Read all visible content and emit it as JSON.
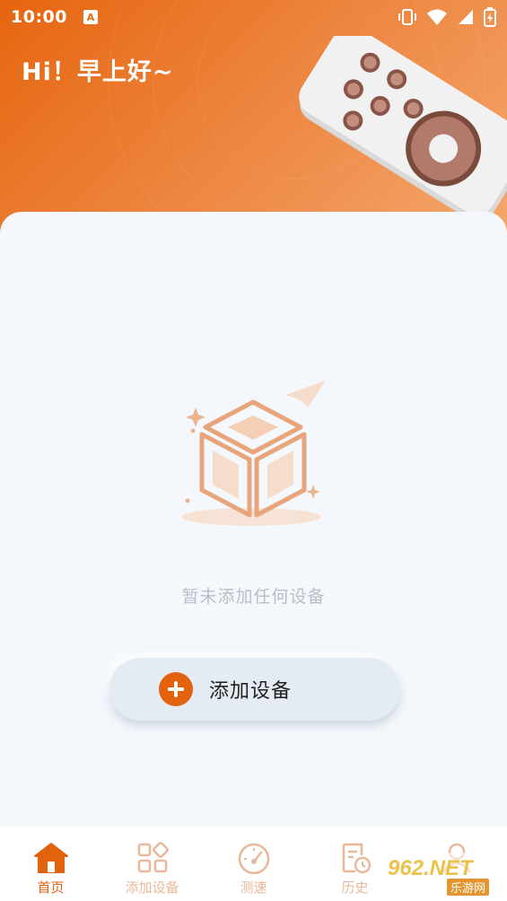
{
  "status_bar": {
    "time": "10:00",
    "notification_icon": "A",
    "icons": [
      "vibrate-icon",
      "wifi-icon",
      "signal-icon",
      "battery-charging-icon"
    ]
  },
  "header": {
    "greeting": "Hi！早上好~"
  },
  "empty_state": {
    "message": "暂未添加任何设备"
  },
  "add_device_button": {
    "label": "添加设备"
  },
  "tabbar": {
    "tabs": [
      {
        "label": "首页",
        "icon": "home-icon",
        "active": true
      },
      {
        "label": "添加设备",
        "icon": "grid-add-icon",
        "active": false
      },
      {
        "label": "测速",
        "icon": "speedometer-icon",
        "active": false
      },
      {
        "label": "历史",
        "icon": "history-icon",
        "active": false
      },
      {
        "label": "",
        "icon": "profile-icon",
        "active": false
      }
    ]
  },
  "watermark": {
    "text": "962.NET",
    "subtext": "乐游网"
  },
  "colors": {
    "accent": "#e2620e",
    "header_start": "#e6650f",
    "header_end": "#f5a96f",
    "inactive_tab": "#e9b89a"
  }
}
